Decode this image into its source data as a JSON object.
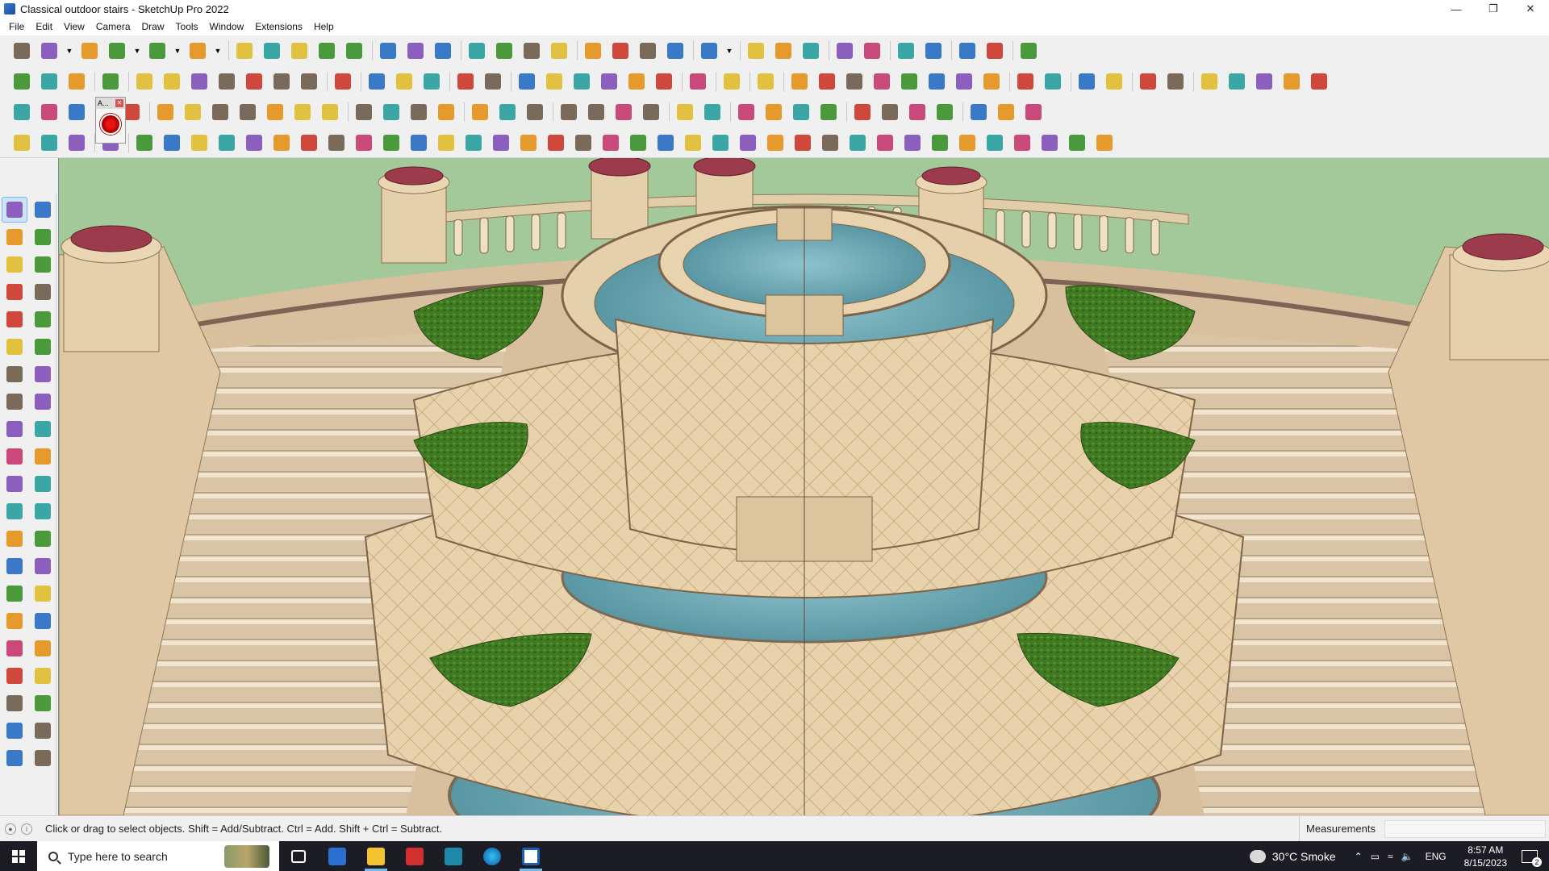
{
  "window": {
    "title": "Classical outdoor stairs - SketchUp Pro 2022",
    "controls": [
      "minimize",
      "restore",
      "close"
    ]
  },
  "menu": [
    "File",
    "Edit",
    "View",
    "Camera",
    "Draw",
    "Tools",
    "Window",
    "Extensions",
    "Help"
  ],
  "floating_toolbar": {
    "title": "A..."
  },
  "status": {
    "hint": "Click or drag to select objects. Shift = Add/Subtract. Ctrl = Add. Shift + Ctrl = Subtract.",
    "measurements_label": "Measurements",
    "measurements_value": ""
  },
  "taskbar": {
    "search_placeholder": "Type here to search",
    "weather": "30°C  Smoke",
    "language": "ENG",
    "time": "8:57 AM",
    "date": "8/15/2023",
    "notifications": "2"
  },
  "colors": {
    "sky": "#a3c99a",
    "stone": "#e6cfa6",
    "water": "#6aa9b6",
    "grass": "#3f7a22",
    "cap": "#9b3b4b",
    "accent": "#0078d7"
  },
  "toolbar_rows": [
    [
      "zoom-icon",
      "select-icon",
      "dropdown",
      "eraser-icon",
      "pencil-icon",
      "dropdown",
      "arc-icon",
      "dropdown",
      "paint-icon",
      "dropdown",
      "sep",
      "push-pull-icon",
      "follow-me-icon",
      "move-icon",
      "rotate-icon",
      "scale-icon",
      "sep",
      "tape-measure-icon",
      "text-icon",
      "paint-bucket-icon",
      "sep",
      "orbit-icon",
      "pan-icon",
      "zoom-window-icon",
      "zoom-extents-icon",
      "sep",
      "iso-view-icon",
      "top-view-icon",
      "front-view-icon",
      "right-view-icon",
      "sep",
      "user-icon",
      "dropdown",
      "sep",
      "3d-warehouse-icon",
      "extension-warehouse-icon",
      "layout-icon",
      "sep",
      "move-up-icon",
      "move-down-icon",
      "sep",
      "dimension-icon",
      "section-plane-icon",
      "sep",
      "undo-icon",
      "redo-icon",
      "sep",
      "ruby-icon"
    ],
    [
      "shaded-icon",
      "xray-icon",
      "back-edges-icon",
      "sep",
      "push-pull-red-icon",
      "sep",
      "arrow-down-icon",
      "arrow-up-icon",
      "arrow-left-icon",
      "arrow-right-icon",
      "arrow-n-icon",
      "arrow-x-icon",
      "arrow-f-icon",
      "sep",
      "curve-icon",
      "sep",
      "sandbox1-icon",
      "sandbox2-icon",
      "sandbox3-icon",
      "sep",
      "terrain1-icon",
      "terrain2-icon",
      "sep",
      "house1-icon",
      "house2-icon",
      "house3-icon",
      "house4-icon",
      "house5-icon",
      "house6-icon",
      "sep",
      "fredo-icon",
      "sep",
      "paint2-icon",
      "sep",
      "measure-red-icon",
      "sep",
      "shape1-icon",
      "shape2-icon",
      "shape3-icon",
      "shape4-icon",
      "shape5-icon",
      "shape6-icon",
      "shape7-icon",
      "shape8-icon",
      "sep",
      "shape9-icon",
      "shape10-icon",
      "sep",
      "eraser2-icon",
      "eraser3-icon",
      "sep",
      "material1-icon",
      "material2-icon",
      "sep",
      "tool1-icon",
      "tool2-icon",
      "tool3-icon",
      "tool4-icon",
      "tool5-icon"
    ],
    [
      "plane-blue-icon",
      "plane-blue2-icon",
      "plane-yellow-icon",
      "plane-red-icon",
      "plane-white-icon",
      "sep",
      "rotate-orange-icon",
      "square-red-icon",
      "square-outline-icon",
      "flag-icon",
      "box-orange-icon",
      "joint-icon",
      "corner-icon",
      "sep",
      "curve-red-icon",
      "plus-red-icon",
      "plus-green-icon",
      "x-blue-icon",
      "sep",
      "cone-green-icon",
      "cone-teal-icon",
      "triangle-yellow-icon",
      "sep",
      "loop-icon",
      "loop2-icon",
      "loop3-icon",
      "move-blue-icon",
      "sep",
      "cube-brown-icon",
      "magnet-icon",
      "sep",
      "green-grid-icon",
      "red-grid-icon",
      "red-grid2-icon",
      "red-cube-icon",
      "sep",
      "panel1-icon",
      "panel2-icon",
      "panel3-icon",
      "panel4-icon",
      "sep",
      "x-red-icon",
      "dots-icon",
      "grid-icon"
    ],
    [
      "curve1-icon",
      "curve2-icon",
      "curve3-icon",
      "sep",
      "arrow-white-icon",
      "sep",
      "shape-a-icon",
      "shape-b-icon",
      "shape-c-icon",
      "shape-d-icon",
      "shape-e-icon",
      "shape-f-icon",
      "shape-g-icon",
      "shape-h-icon",
      "shape-i-icon",
      "shape-j-icon",
      "shape-k-icon",
      "shape-l-icon",
      "shape-m-icon",
      "shape-n-icon",
      "shape-o-icon",
      "shape-p-icon",
      "shape-q-icon",
      "shape-r-icon",
      "shape-s-icon",
      "shape-t-icon",
      "shape-u-icon",
      "shape-v-icon",
      "shape-w-icon",
      "shape-x-icon",
      "shape-y-icon",
      "shape-z-icon",
      "shape-aa-icon",
      "shape-bb-icon",
      "shape-cc-icon",
      "shape-dd-icon",
      "shape-ee-icon",
      "shape-ff-icon",
      "shape-gg-icon",
      "shape-hh-icon",
      "shape-ii-icon",
      "shape-jj-icon"
    ]
  ],
  "palette": [
    [
      "select-tool-icon",
      "orbit-tool-icon"
    ],
    [
      "paint-bucket-tool-icon",
      "eraser-tool-icon"
    ],
    [
      "make-component-tool-icon",
      "tag-tool-icon"
    ],
    [
      "line-tool-icon",
      "freehand-tool-icon"
    ],
    [
      "rectangle-tool-icon",
      "rotated-rectangle-tool-icon"
    ],
    [
      "circle-tool-icon",
      "polygon-tool-icon"
    ],
    [
      "arc-tool-icon",
      "two-point-arc-tool-icon"
    ],
    [
      "pie-tool-icon",
      "three-point-arc-tool-icon"
    ],
    [
      "move-tool-icon",
      "push-pull-tool-icon"
    ],
    [
      "rotate-tool-icon",
      "follow-me-tool-icon"
    ],
    [
      "scale-tool-icon",
      "offset-tool-icon"
    ],
    [
      "tape-measure-tool-icon",
      "dimension-tool-icon"
    ],
    [
      "protractor-tool-icon",
      "text-tool-icon"
    ],
    [
      "axes-tool-icon",
      "3d-text-tool-icon"
    ],
    [
      "orbit2-tool-icon",
      "pan-tool-icon"
    ],
    [
      "zoom-tool-icon",
      "zoom-window-tool-icon"
    ],
    [
      "zoom-extents-tool-icon",
      "previous-view-tool-icon"
    ],
    [
      "position-camera-tool-icon",
      "look-around-tool-icon"
    ],
    [
      "walk-tool-icon",
      "section-plane-tool-icon"
    ],
    [
      "sandbox-from-contours-icon",
      "sandbox-from-scratch-icon"
    ],
    [
      "smoove-tool-icon",
      "stamp-tool-icon"
    ]
  ]
}
